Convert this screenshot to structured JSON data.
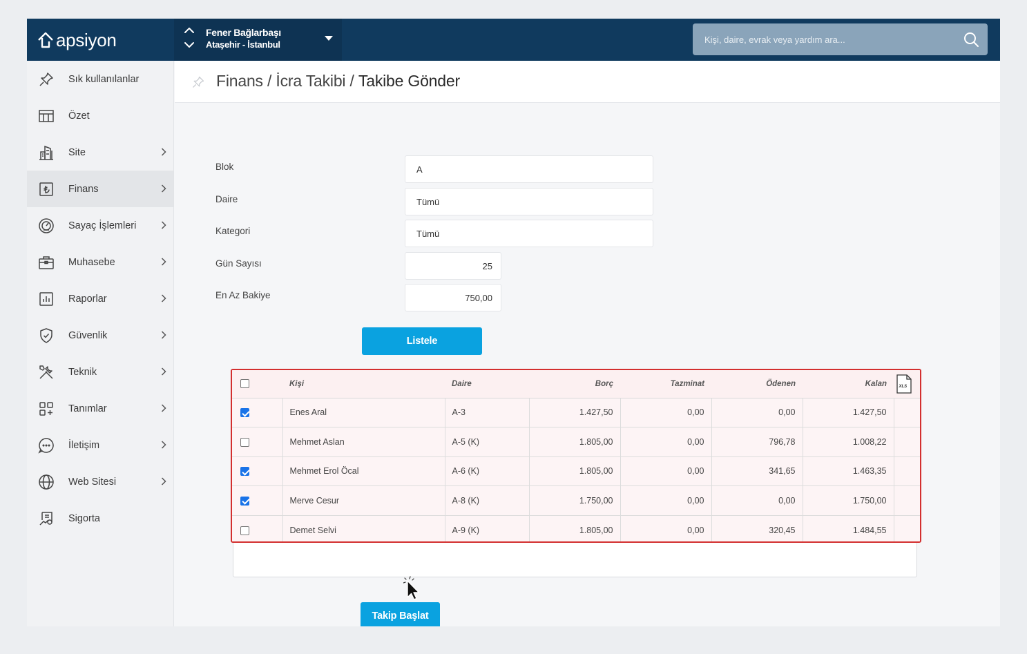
{
  "topbar": {
    "logo_text": "apsiyon",
    "site_name": "Fener Bağlarbaşı",
    "site_location": "Ataşehir - İstanbul",
    "search_placeholder": "Kişi, daire, evrak veya yardım ara..."
  },
  "sidebar": {
    "items": [
      {
        "label": "Sık kullanılanlar",
        "icon": "pin-icon",
        "has_arrow": false
      },
      {
        "label": "Özet",
        "icon": "table-icon",
        "has_arrow": false
      },
      {
        "label": "Site",
        "icon": "building-icon",
        "has_arrow": true
      },
      {
        "label": "Finans",
        "icon": "lira-icon",
        "has_arrow": true,
        "active": true
      },
      {
        "label": "Sayaç İşlemleri",
        "icon": "gauge-icon",
        "has_arrow": true
      },
      {
        "label": "Muhasebe",
        "icon": "briefcase-icon",
        "has_arrow": true
      },
      {
        "label": "Raporlar",
        "icon": "report-chart-icon",
        "has_arrow": true
      },
      {
        "label": "Güvenlik",
        "icon": "shield-icon",
        "has_arrow": true
      },
      {
        "label": "Teknik",
        "icon": "tools-icon",
        "has_arrow": true
      },
      {
        "label": "Tanımlar",
        "icon": "grid-plus-icon",
        "has_arrow": true
      },
      {
        "label": "İletişim",
        "icon": "chat-icon",
        "has_arrow": true
      },
      {
        "label": "Web Sitesi",
        "icon": "globe-icon",
        "has_arrow": true
      },
      {
        "label": "Sigorta",
        "icon": "insurance-doc-icon",
        "has_arrow": false
      }
    ]
  },
  "header": {
    "crumb1": "Finans",
    "sep": " / ",
    "crumb2": "İcra Takibi",
    "current": "Takibe Gönder"
  },
  "form": {
    "blok_label": "Blok",
    "blok_value": "A",
    "daire_label": "Daire",
    "daire_value": "Tümü",
    "kategori_label": "Kategori",
    "kategori_value": "Tümü",
    "gun_label": "Gün Sayısı",
    "gun_value": "25",
    "bakiye_label": "En Az Bakiye",
    "bakiye_value": "750,00",
    "list_button": "Listele"
  },
  "table": {
    "columns": [
      "Kişi",
      "Daire",
      "Borç",
      "Tazminat",
      "Ödenen",
      "Kalan"
    ],
    "export_icon": "xls-file-icon",
    "rows": [
      {
        "checked": true,
        "kisi": "Enes Aral",
        "daire": "A-3",
        "borc": "1.427,50",
        "tazminat": "0,00",
        "odenen": "0,00",
        "kalan": "1.427,50"
      },
      {
        "checked": false,
        "kisi": "Mehmet Aslan",
        "daire": "A-5 (K)",
        "borc": "1.805,00",
        "tazminat": "0,00",
        "odenen": "796,78",
        "kalan": "1.008,22"
      },
      {
        "checked": true,
        "kisi": "Mehmet Erol Öcal",
        "daire": "A-6 (K)",
        "borc": "1.805,00",
        "tazminat": "0,00",
        "odenen": "341,65",
        "kalan": "1.463,35"
      },
      {
        "checked": true,
        "kisi": "Merve Cesur",
        "daire": "A-8 (K)",
        "borc": "1.750,00",
        "tazminat": "0,00",
        "odenen": "0,00",
        "kalan": "1.750,00"
      },
      {
        "checked": false,
        "kisi": "Demet Selvi",
        "daire": "A-9 (K)",
        "borc": "1.805,00",
        "tazminat": "0,00",
        "odenen": "320,45",
        "kalan": "1.484,55"
      }
    ]
  },
  "actions": {
    "start_button": "Takip Başlat"
  },
  "colors": {
    "topbar": "#103a5e",
    "accent": "#0aa2e0",
    "highlight_border": "#d32f2f"
  }
}
